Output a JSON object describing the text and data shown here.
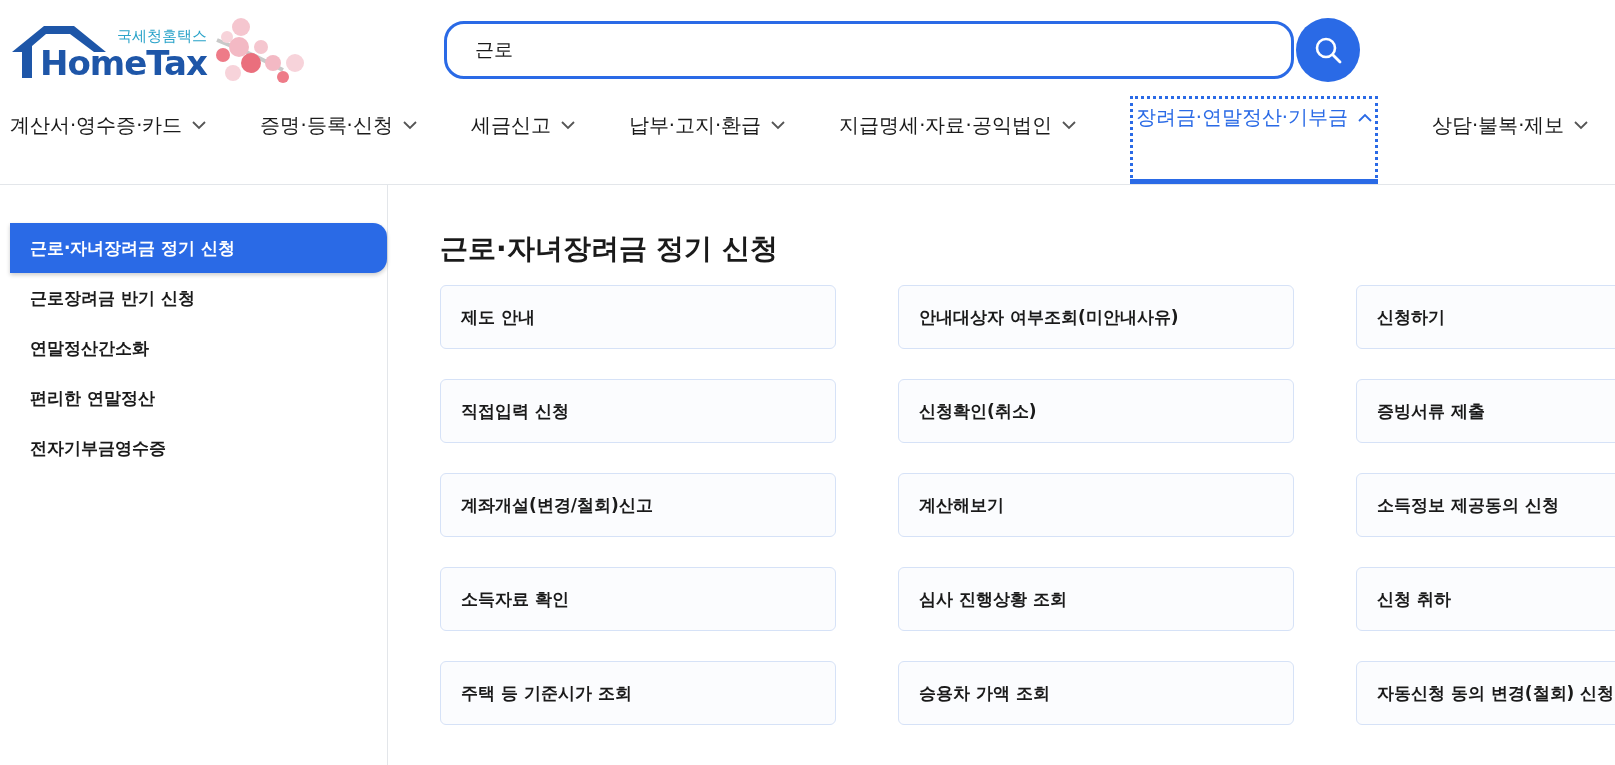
{
  "logo": {
    "subtitle": "국세청홈택스",
    "name": "HomeTax"
  },
  "search": {
    "value": "근로"
  },
  "nav": [
    {
      "label": "계산서·영수증·카드",
      "selected": false
    },
    {
      "label": "증명·등록·신청",
      "selected": false
    },
    {
      "label": "세금신고",
      "selected": false
    },
    {
      "label": "납부·고지·환급",
      "selected": false
    },
    {
      "label": "지급명세·자료·공익법인",
      "selected": false
    },
    {
      "label": "장려금·연말정산·기부금",
      "selected": true
    },
    {
      "label": "상담·불복·제보",
      "selected": false
    }
  ],
  "sidebar": {
    "items": [
      {
        "label": "근로·자녀장려금 정기 신청",
        "selected": true
      },
      {
        "label": "근로장려금 반기 신청",
        "selected": false
      },
      {
        "label": "연말정산간소화",
        "selected": false
      },
      {
        "label": "편리한 연말정산",
        "selected": false
      },
      {
        "label": "전자기부금영수증",
        "selected": false
      }
    ]
  },
  "content": {
    "title": "근로·자녀장려금 정기 신청",
    "links": [
      "제도 안내",
      "안내대상자 여부조회(미안내사유)",
      "신청하기",
      "직접입력 신청",
      "신청확인(취소)",
      "증빙서류 제출",
      "계좌개설(변경/철회)신고",
      "계산해보기",
      "소득정보 제공동의 신청",
      "소득자료 확인",
      "심사 진행상황 조회",
      "신청 취하",
      "주택 등 기준시가 조회",
      "승용차 가액 조회",
      "자동신청 동의 변경(철회) 신청"
    ]
  }
}
